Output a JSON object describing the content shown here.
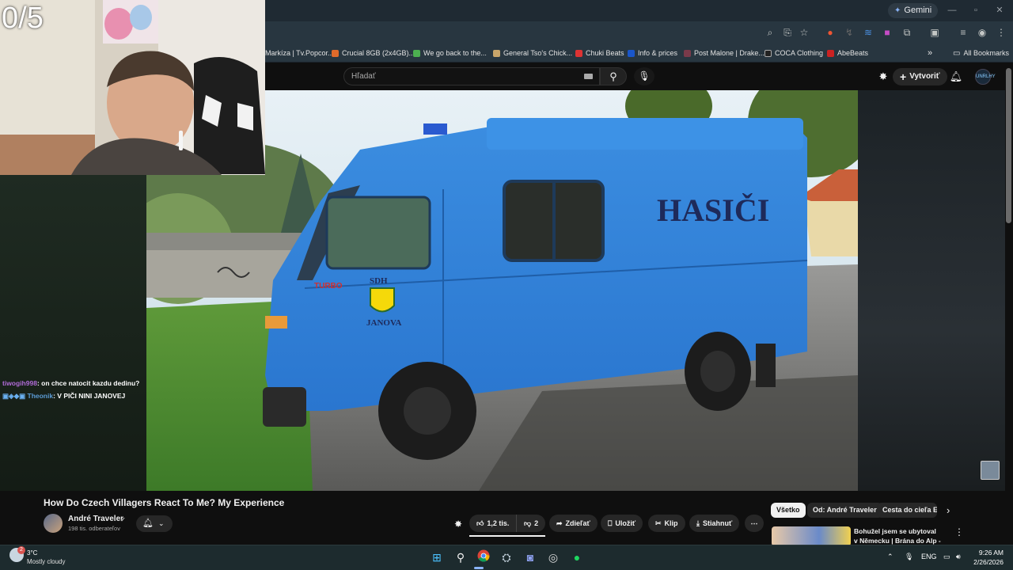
{
  "stream": {
    "counter": "0/5",
    "chat": [
      {
        "user": "tiwogih998",
        "message": ": on chce natocit kazdu dedinu?",
        "user_color": "#b06bd6"
      },
      {
        "user": "Theonik",
        "message": ": V PIČI NINI JANOVEJ",
        "user_color": "#5b9bd5"
      }
    ]
  },
  "browser": {
    "gemini_label": "Gemini",
    "bookmarks": [
      {
        "label": "Markíza | Tv.Popcor...",
        "color": "#3a7bd5"
      },
      {
        "label": "Crucial 8GB (2x4GB)...",
        "color": "#e06a2a"
      },
      {
        "label": "We go back to the...",
        "color": "#4caf50"
      },
      {
        "label": "General Tso's Chick...",
        "color": "#c8a56a"
      },
      {
        "label": "Chuki Beats",
        "color": "#d33"
      },
      {
        "label": "Info & prices",
        "color": "#1a56c9"
      },
      {
        "label": "Post Malone | Drake...",
        "color": "#7a3a4a"
      },
      {
        "label": "COCA Clothing",
        "color": "#222"
      },
      {
        "label": "AbeBeats",
        "color": "#c22"
      }
    ],
    "all_bookmarks": "All Bookmarks"
  },
  "youtube": {
    "search_placeholder": "Hľadať",
    "create_label": "Vytvoriť",
    "avatar_text": "UNRLHY",
    "video_title": "How Do Czech Villagers React To Me? My Experience",
    "channel_name": "André Traveler",
    "subscribers": "198 tis. odberateľov",
    "likes": "1,2 tis.",
    "dislikes": "2",
    "share_label": "Zdieľať",
    "save_label": "Uložiť",
    "clip_label": "Klip",
    "download_label": "Stiahnuť",
    "chips": [
      "Všetko",
      "Od: André Traveler",
      "Cesta do cieľa Eu"
    ],
    "recommendation_title": "Bohužel jsem se ubytoval v Německu | Brána do Alp - ...",
    "van_text": "HASIČI",
    "van_sdh": "SDH",
    "van_village": "JANOVA",
    "van_badge": "TURBO"
  },
  "taskbar": {
    "weather_temp": "3°C",
    "weather_desc": "Mostly cloudy",
    "weather_badge": "2",
    "lang": "ENG",
    "time": "9:26 AM",
    "date": "2/26/2026"
  }
}
